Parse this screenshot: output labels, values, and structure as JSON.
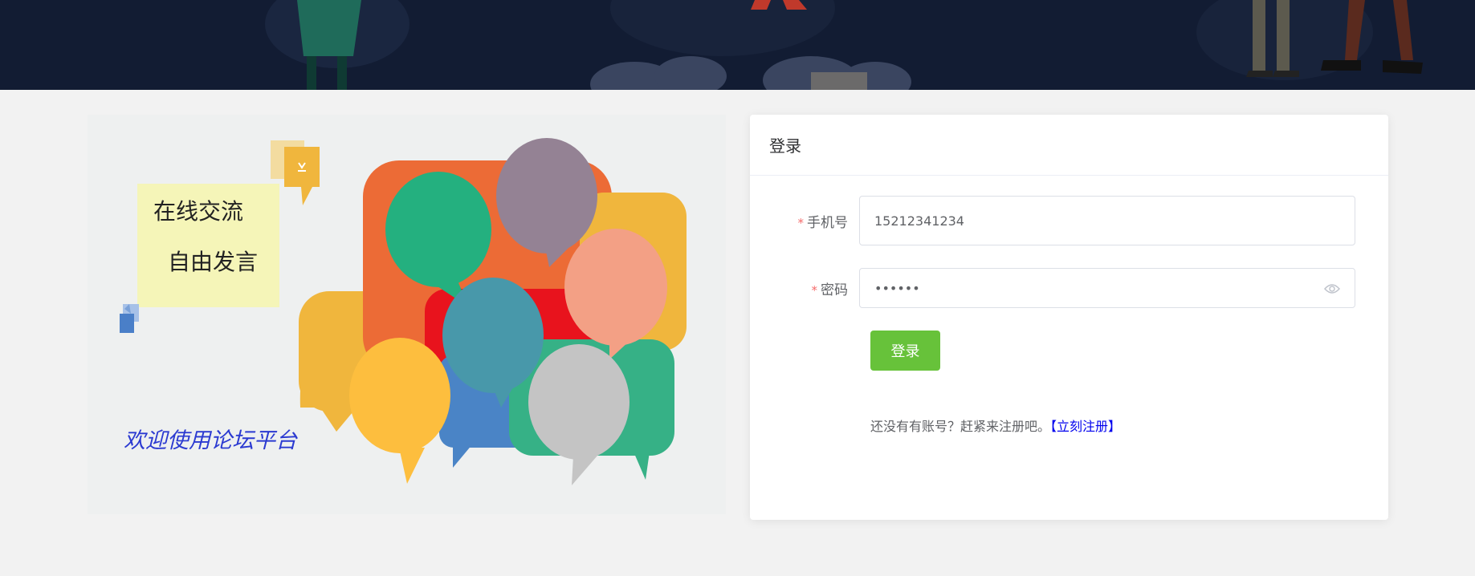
{
  "login": {
    "title": "登录",
    "phone": {
      "label": "手机号",
      "required_mark": "*",
      "value": "15212341234"
    },
    "password": {
      "label": "密码",
      "required_mark": "*",
      "value": "••••••"
    },
    "submit_label": "登录",
    "register_prompt": "还没有有账号？赶紧来注册吧。",
    "register_link": "【立刻注册】"
  },
  "illustration": {
    "note_line1": "在线交流",
    "note_line2": "自由发言",
    "welcome": "欢迎使用论坛平台"
  },
  "colors": {
    "primary_button": "#67c23a",
    "banner": "#121c33",
    "link": "#0000ee"
  }
}
